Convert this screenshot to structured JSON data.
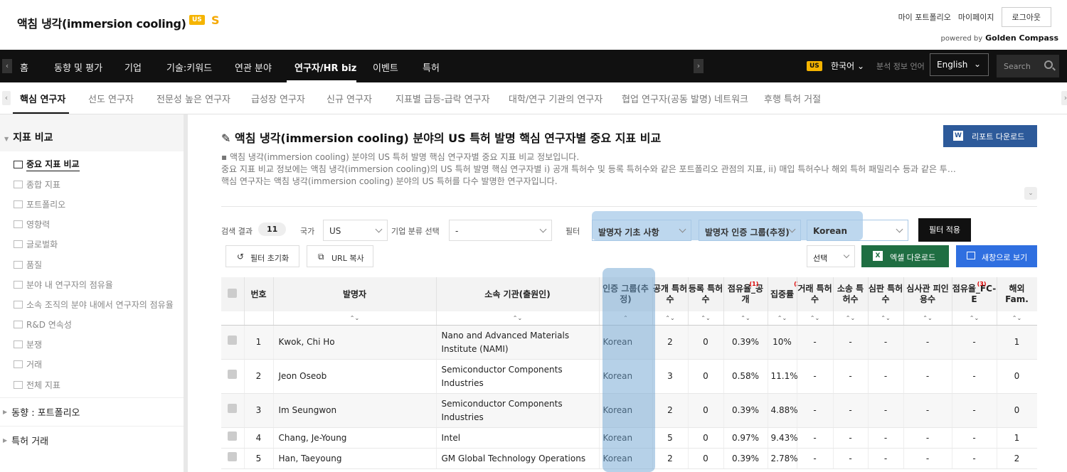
{
  "header": {
    "title": "액침 냉각(immersion cooling)",
    "badge": "US",
    "s_mark": "S",
    "links": [
      "마이 포트폴리오",
      "마이페이지"
    ],
    "logout": "로그아웃",
    "powered_by": "powered by",
    "powered_brand": "Golden Compass"
  },
  "nav": {
    "items": [
      "홈",
      "동향 및 평가",
      "기업",
      "기술:키워드",
      "연관 분야",
      "연구자/HR biz",
      "이벤트",
      "특허"
    ],
    "active_index": 5,
    "lang_badge": "US",
    "lang_label": "한국어",
    "analysis_lang_label": "분석 정보 언어",
    "analysis_lang_value": "English",
    "search_placeholder": "Search"
  },
  "subtabs": {
    "items": [
      "핵심 연구자",
      "선도 연구자",
      "전문성 높은 연구자",
      "급성장 연구자",
      "신규 연구자",
      "지표별 급등-급락 연구자",
      "대학/연구 기관의 연구자",
      "협업 연구자(공동 발명) 네트워크",
      "후행 특허 거절"
    ],
    "active_index": 0
  },
  "sidebar": {
    "open_section": "지표 비교",
    "items": [
      "중요 지표 비교",
      "종합 지표",
      "포트폴리오",
      "영향력",
      "글로벌화",
      "품질",
      "분야 내 연구자의 점유율",
      "소속 조직의 분야 내에서 연구자의 점유율",
      "R&D 연속성",
      "분쟁",
      "거래",
      "전체 지표"
    ],
    "active_index": 0,
    "collapsed_sections": [
      "동향 : 포트폴리오",
      "특허 거래"
    ]
  },
  "main": {
    "title": "액침 냉각(immersion cooling) 분야의 US 특허 발명 핵심 연구자별 중요 지표 비교",
    "report_button": "리포트 다운로드",
    "desc_line1": "액침 냉각(immersion cooling) 분야의 US 특허 발명 핵심 연구자별 중요 지표 비교 정보입니다.",
    "desc_line2": "중요 지표 비교 정보에는 액침 냉각(immersion cooling)의 US 특허 발명 핵심 연구자별 i) 공개 특허수 및 등록 특허수와 같은 포트폴리오 관점의 지표, ii) 매입 특허수나 해외 특허 패밀리수 등과 같은 투…",
    "desc_line3": "핵심 연구자는 액침 냉각(immersion cooling) 분야의 US 특허를 다수 발명한 연구자입니다."
  },
  "filters": {
    "result_label": "검색 결과",
    "result_count": "11",
    "country_label": "국가",
    "country_value": "US",
    "company_class_label": "기업 분류 선택",
    "company_class_value": "-",
    "filter_label": "필터",
    "filter1": "발명자 기초 사항",
    "filter2": "발명자 인증 그룹(추정)",
    "filter3": "Korean",
    "apply": "필터 적용",
    "reset": "필터 초기화",
    "copy_url": "URL 복사",
    "choose": "선택",
    "excel": "엑셀 다운로드",
    "new_window": "새창으로 보기"
  },
  "table": {
    "headers": [
      "",
      "번호",
      "발명자",
      "소속 기관(출원인)",
      "인증 그룹(추정)",
      "공개 특허수",
      "등록 특허수",
      "점유율_공개",
      "집중률",
      "거래 특허수",
      "소송 특허수",
      "심판 특허수",
      "심사관 피인용수",
      "점유율_FC-E",
      "해외 Fam."
    ],
    "header_notes": {
      "7": "(1)",
      "8": "(2)",
      "13": "(3)"
    },
    "sort_marks": [
      "",
      "",
      "⌃⌄",
      "⌃⌄",
      "⌃",
      "⌃⌄",
      "⌃⌄",
      "⌃⌄",
      "⌃⌄",
      "⌃⌄",
      "⌃⌄",
      "⌃⌄",
      "⌃⌄",
      "⌃⌄",
      "⌃⌄"
    ],
    "rows": [
      [
        "1",
        "Kwok, Chi Ho",
        "Nano and Advanced Materials Institute (NAMI)",
        "Korean",
        "2",
        "0",
        "0.39%",
        "10%",
        "-",
        "-",
        "-",
        "-",
        "-",
        "1"
      ],
      [
        "2",
        "Jeon Oseob",
        "Semiconductor Components Industries",
        "Korean",
        "3",
        "0",
        "0.58%",
        "11.1%",
        "-",
        "-",
        "-",
        "-",
        "-",
        "0"
      ],
      [
        "3",
        "Im Seungwon",
        "Semiconductor Components Industries",
        "Korean",
        "2",
        "0",
        "0.39%",
        "4.88%",
        "-",
        "-",
        "-",
        "-",
        "-",
        "0"
      ],
      [
        "4",
        "Chang, Je-Young",
        "Intel",
        "Korean",
        "5",
        "0",
        "0.97%",
        "9.43%",
        "-",
        "-",
        "-",
        "-",
        "-",
        "1"
      ],
      [
        "5",
        "Han, Taeyoung",
        "GM Global Technology Operations",
        "Korean",
        "2",
        "0",
        "0.39%",
        "2.78%",
        "-",
        "-",
        "-",
        "-",
        "-",
        "2"
      ]
    ]
  }
}
